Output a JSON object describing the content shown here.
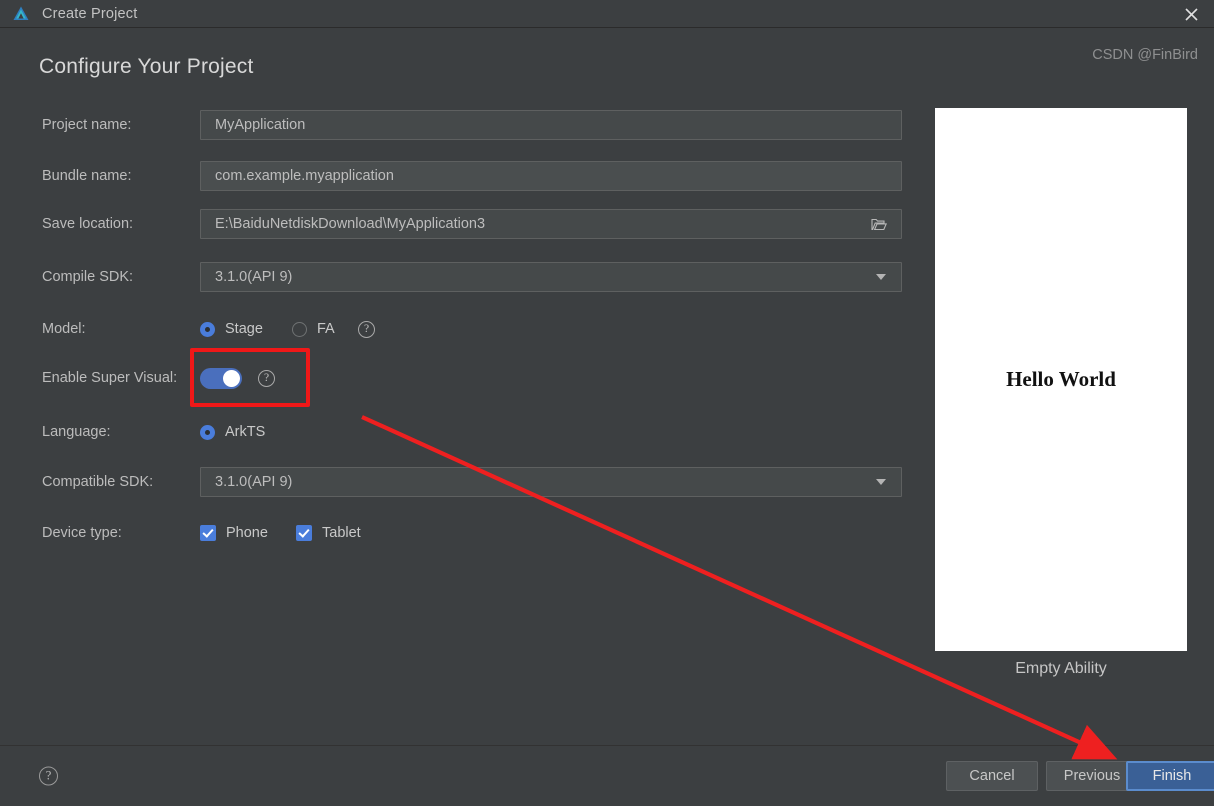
{
  "window": {
    "title": "Create Project",
    "logo_icon": "deveco-logo-icon",
    "close_icon": "close-icon"
  },
  "page": {
    "heading": "Configure Your Project"
  },
  "form": {
    "project_name": {
      "label": "Project name:",
      "value": "MyApplication"
    },
    "bundle_name": {
      "label": "Bundle name:",
      "value": "com.example.myapplication"
    },
    "save_location": {
      "label": "Save location:",
      "value": "E:\\BaiduNetdiskDownload\\MyApplication3",
      "browse_icon": "folder-open-icon"
    },
    "compile_sdk": {
      "label": "Compile SDK:",
      "value": "3.1.0(API 9)",
      "arrow_icon": "chevron-down-icon"
    },
    "model": {
      "label": "Model:",
      "options": [
        {
          "label": "Stage",
          "selected": true
        },
        {
          "label": "FA",
          "selected": false
        }
      ],
      "help_icon": "help-circle-icon",
      "help_glyph": "?"
    },
    "super_visual": {
      "label": "Enable Super Visual:",
      "enabled": true,
      "help_icon": "help-circle-icon",
      "help_glyph": "?"
    },
    "language": {
      "label": "Language:",
      "options": [
        {
          "label": "ArkTS",
          "selected": true
        }
      ]
    },
    "compatible_sdk": {
      "label": "Compatible SDK:",
      "value": "3.1.0(API 9)",
      "arrow_icon": "chevron-down-icon"
    },
    "device_type": {
      "label": "Device type:",
      "options": [
        {
          "label": "Phone",
          "checked": true
        },
        {
          "label": "Tablet",
          "checked": true
        }
      ]
    }
  },
  "preview": {
    "screen_text": "Hello World",
    "caption": "Empty Ability"
  },
  "footer": {
    "help_icon": "help-circle-icon",
    "help_glyph": "?",
    "cancel_label": "Cancel",
    "previous_label": "Previous",
    "finish_label": "Finish"
  },
  "watermark": {
    "text": "CSDN @FinBird"
  },
  "annotations": {
    "highlight_color": "#f01818",
    "box_target": "enable-super-visual-toggle",
    "arrow_target": "finish-button"
  }
}
